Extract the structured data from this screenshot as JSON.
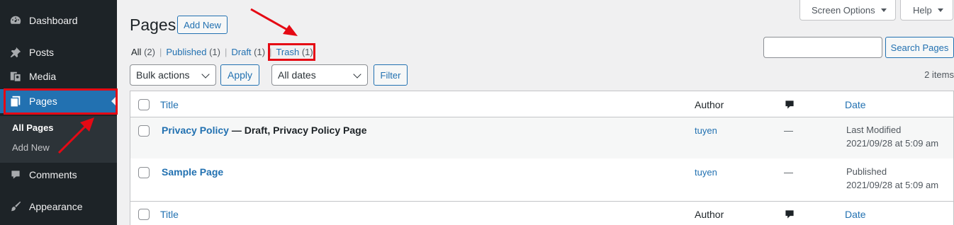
{
  "sidebar": {
    "items": [
      {
        "label": "Dashboard",
        "icon": "dashboard-icon"
      },
      {
        "label": "Posts",
        "icon": "pin-icon"
      },
      {
        "label": "Media",
        "icon": "media-icon"
      },
      {
        "label": "Pages",
        "icon": "pages-icon"
      },
      {
        "label": "Comments",
        "icon": "comment-icon"
      },
      {
        "label": "Appearance",
        "icon": "brush-icon"
      }
    ],
    "submenu": [
      "All Pages",
      "Add New"
    ]
  },
  "header": {
    "title": "Pages",
    "add_new": "Add New",
    "screen_options": "Screen Options",
    "help": "Help"
  },
  "views": {
    "all": "All",
    "all_count": "(2)",
    "published": "Published",
    "published_count": "(1)",
    "draft": "Draft",
    "draft_count": "(1)",
    "trash": "Trash",
    "trash_count": "(1)",
    "separator": "|"
  },
  "filters": {
    "bulk_actions": "Bulk actions",
    "apply": "Apply",
    "dates": "All dates",
    "filter": "Filter"
  },
  "search": {
    "button": "Search Pages",
    "value": ""
  },
  "items_count": "2 items",
  "table": {
    "headers": {
      "title": "Title",
      "author": "Author",
      "date": "Date"
    },
    "rows": [
      {
        "title": "Privacy Policy",
        "state": " — Draft, Privacy Policy Page",
        "author": "tuyen",
        "comments": "—",
        "date_status": "Last Modified",
        "date": "2021/09/28 at 5:09 am"
      },
      {
        "title": "Sample Page",
        "state": "",
        "author": "tuyen",
        "comments": "—",
        "date_status": "Published",
        "date": "2021/09/28 at 5:09 am"
      }
    ]
  },
  "colors": {
    "accent": "#2271b1",
    "annotation": "#e50914",
    "sidebar_bg": "#1d2327",
    "active_bg": "#2271b1"
  }
}
